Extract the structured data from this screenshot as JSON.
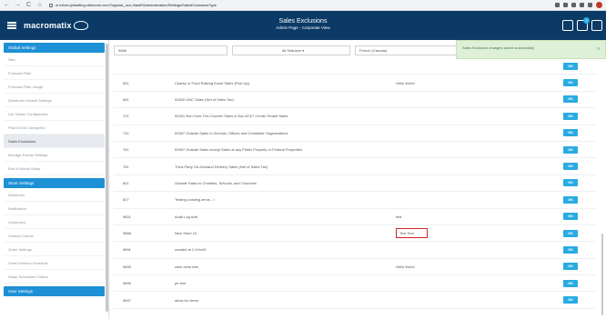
{
  "browser": {
    "url": "m.inform.jetsetting.cbekome.com/Toypass_oco-/trawR/Administration/Settings/SalesExclusionsType",
    "back": "←",
    "forward": "→",
    "reload": "C",
    "home": "⌂"
  },
  "header": {
    "logo_text": "macromatix",
    "title": "Sales Exclusions",
    "subtitle": "Admin Page - Corporate View",
    "notification_count": "2"
  },
  "toast": {
    "message": "Sales Exclusion changes saved successfully",
    "close": "×"
  },
  "sidebar": {
    "sections": [
      {
        "heading": "Global Settings",
        "items": [
          "Size",
          "Forecast Filter",
          "Forecast Filter Usage",
          "Distributor Default Settings",
          "List Option Configuration",
          "Paid In/Out Categories",
          "Sales Exclusions",
          "Manage Events Settings",
          "End of Month Setup"
        ]
      },
      {
        "heading": "Store Settings",
        "items": [
          "Distributor",
          "Notification",
          "Customers",
          "Custom Counts",
          "Order Settings",
          "Order Delivery Schedule",
          "Setup Scheduled Orders"
        ]
      },
      {
        "heading": "User Settings",
        "items": []
      }
    ],
    "active_item": "Sales Exclusions"
  },
  "filters": {
    "code_value": "9888",
    "status_value": "All Statuses ▾",
    "language_value": "French (Canada)"
  },
  "table": {
    "button_label": "OK",
    "rows": [
      {
        "code": "",
        "name": "",
        "alt": ""
      },
      {
        "code": "581",
        "name": "Charity or Fund Raising Event Sales (Pick Up)",
        "alt": "Hello World"
      },
      {
        "code": "661",
        "name": "00400 UNC Sales (Net of Sales Tax)",
        "alt": ""
      },
      {
        "code": "721",
        "name": "00341 Non Over-The-Counter Sales & Non AT&T Center Tenant Sales",
        "alt": ""
      },
      {
        "code": "741",
        "name": "00307 Outside Sales to Schools, Offices and Charitable Organizations",
        "alt": ""
      },
      {
        "code": "761",
        "name": "00907 Outside Sales except Sales at any Public Property or Federal Properties",
        "alt": ""
      },
      {
        "code": "781",
        "name": "Third-Party On-Demand Delivery Sales (Net of Sales Tax)",
        "alt": ""
      },
      {
        "code": "801",
        "name": "Outside Sales to Charities, Schools, and Churches",
        "alt": ""
      },
      {
        "code": "827",
        "name": "Testing Leading zeros - I",
        "alt": ""
      },
      {
        "code": "9801",
        "name": "Audit Log Add",
        "alt": "test"
      },
      {
        "code": "9888",
        "name": "New Store 10",
        "alt": "Test Test"
      },
      {
        "code": "9891",
        "name": "created at 1:10m49",
        "alt": ""
      },
      {
        "code": "9895",
        "name": "zach clear test",
        "alt": "Hello World"
      },
      {
        "code": "9896",
        "name": "jer test",
        "alt": ""
      },
      {
        "code": "9897",
        "name": "show for demo",
        "alt": ""
      }
    ],
    "highlighted_code": "9888"
  }
}
